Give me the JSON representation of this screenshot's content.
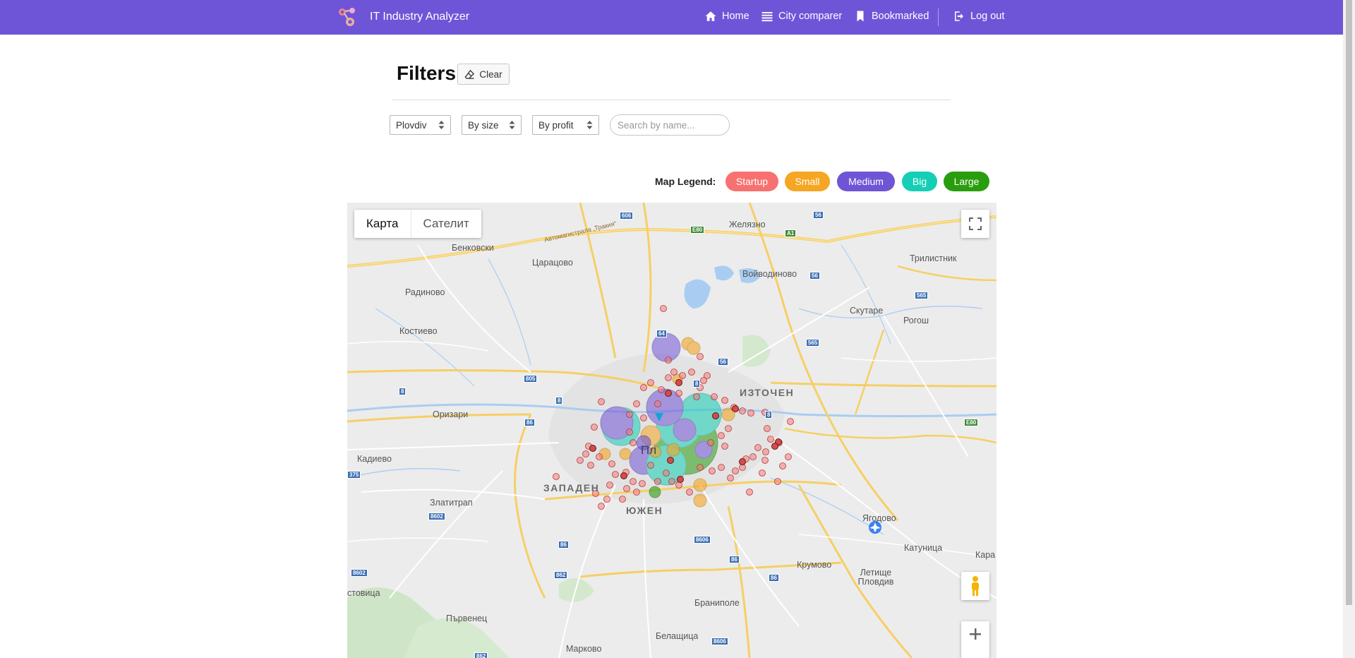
{
  "navbar": {
    "brand_title": "IT Industry Analyzer",
    "links": [
      {
        "label": "Home",
        "icon": "home-icon"
      },
      {
        "label": "City comparer",
        "icon": "list-icon"
      },
      {
        "label": "Bookmarked",
        "icon": "bookmark-icon"
      },
      {
        "label": "Log out",
        "icon": "logout-icon"
      }
    ]
  },
  "filters": {
    "title": "Filters",
    "clear_label": "Clear",
    "city_select": "Plovdiv",
    "size_select": "By size",
    "profit_select": "By profit",
    "search_placeholder": "Search by name..."
  },
  "legend": {
    "label": "Map Legend:",
    "items": [
      {
        "label": "Startup",
        "color": "#f87171"
      },
      {
        "label": "Small",
        "color": "#f5a623"
      },
      {
        "label": "Medium",
        "color": "#6f55d6"
      },
      {
        "label": "Big",
        "color": "#14cfb5"
      },
      {
        "label": "Large",
        "color": "#2a9d0f"
      }
    ]
  },
  "map": {
    "map_type_map": "Карта",
    "map_type_satellite": "Сателит",
    "places": [
      "Желязно",
      "Бенковски",
      "Царацово",
      "Войводиново",
      "Трилистник",
      "Радиново",
      "Скутаре",
      "Рогош",
      "Костиево",
      "ИЗТОЧЕН",
      "Оризари",
      "Кадиево",
      "ЗАПАДЕН",
      "Златитрап",
      "ЮЖЕН",
      "Ягодово",
      "Катуница",
      "Кара",
      "Крумово",
      "Летище Пловдив",
      "стовица",
      "Браниполе",
      "Първенец",
      "Белащица",
      "Марково",
      "Пл",
      "Автомагистрала „Тракия“"
    ],
    "road_numbers": [
      "606",
      "56",
      "E80",
      "A1",
      "56",
      "565",
      "565",
      "805",
      "8",
      "8",
      "86",
      "375",
      "8602",
      "86",
      "8606",
      "86",
      "86",
      "862",
      "8602",
      "8606",
      "862",
      "E80",
      "64",
      "56",
      "8",
      "8"
    ]
  }
}
